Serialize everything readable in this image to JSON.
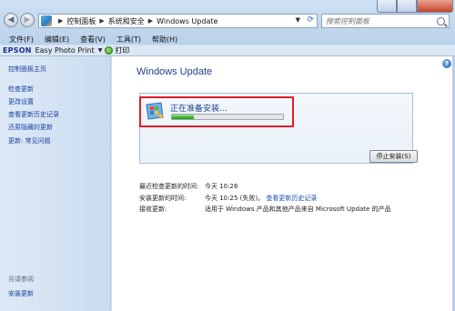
{
  "address_bar": {
    "crumbs": [
      "控制面板",
      "系统和安全",
      "Windows Update"
    ]
  },
  "search": {
    "placeholder": "搜索控制面板"
  },
  "menu": [
    "文件(F)",
    "编辑(E)",
    "查看(V)",
    "工具(T)",
    "帮助(H)"
  ],
  "toolbar": {
    "brand": "EPSON",
    "app": "Easy Photo Print",
    "print": "打印"
  },
  "sidebar": {
    "home": "控制面板主页",
    "items": [
      "检查更新",
      "更改设置",
      "查看更新历史记录",
      "还原隐藏的更新",
      "更新: 常见问题"
    ],
    "see_also": "另请参阅",
    "installed": "安装更新"
  },
  "main": {
    "title": "Windows Update",
    "status": "正在准备安装...",
    "progress": 0.2,
    "stop_button": "停止安装(S)",
    "info": [
      {
        "label": "最近检查更新的时间:",
        "value": "今天 10:26",
        "link": ""
      },
      {
        "label": "安装更新的时间:",
        "value": "今天 10:25 (失败)。",
        "link": "查看更新历史记录"
      },
      {
        "label": "接收更新:",
        "value": "适用于 Windows 产品和其他产品来自 Microsoft Update 的产品",
        "link": ""
      }
    ]
  },
  "colors": {
    "highlight": "#e01e2a",
    "link": "#1a4fb3",
    "title": "#1e3f8d"
  }
}
